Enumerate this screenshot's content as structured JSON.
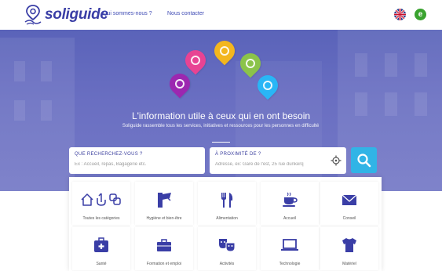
{
  "header": {
    "logo_text": "soliguide",
    "nav": {
      "qui": "Qui sommes-nous ?",
      "contact": "Nous contacter"
    },
    "lang_button": "e"
  },
  "hero": {
    "title": "L'information utile à ceux qui en ont besoin",
    "subtitle": "Soliguide rassemble tous les services, initiatives et ressources pour les personnes en difficulté"
  },
  "search": {
    "what": {
      "label": "QUE RECHERCHEZ-VOUS ?",
      "placeholder": "Ex : Accueil, repas, Bagagerie etc."
    },
    "where": {
      "label": "À PROXIMITÉ DE ?",
      "placeholder": "Adresse, ex: Gare de l'est, 25 rue dunkerq"
    }
  },
  "categories": [
    {
      "label": "Toutes les catégories",
      "icon": "all-categories-icon"
    },
    {
      "label": "Hygiène et bien-être",
      "icon": "hygiene-icon"
    },
    {
      "label": "Alimentation",
      "icon": "food-icon"
    },
    {
      "label": "Accueil",
      "icon": "coffee-cup-icon"
    },
    {
      "label": "Conseil",
      "icon": "envelope-icon"
    },
    {
      "label": "Santé",
      "icon": "medical-kit-icon"
    },
    {
      "label": "Formation et emploi",
      "icon": "briefcase-icon"
    },
    {
      "label": "Activités",
      "icon": "theater-masks-icon"
    },
    {
      "label": "Technologie",
      "icon": "laptop-icon"
    },
    {
      "label": "Matériel",
      "icon": "tshirt-icon"
    }
  ],
  "colors": {
    "brand": "#3a3ea6",
    "hero": "#6a6fc2",
    "search_button": "#31b4e6",
    "icon": "#3a3ea6"
  }
}
